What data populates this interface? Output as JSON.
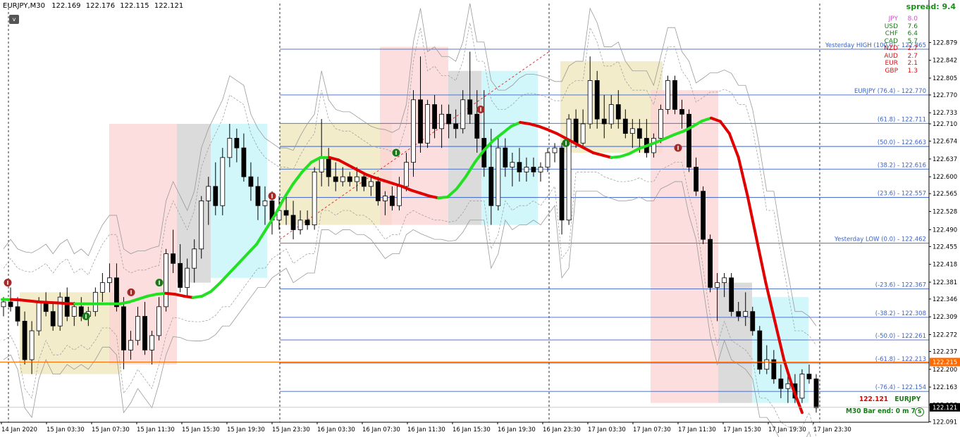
{
  "window": {
    "symbol": "EURJPY,M30",
    "ohlc": [
      "122.169",
      "122.176",
      "122.115",
      "122.121"
    ],
    "collapse_button": "v"
  },
  "spread_label": "spread: 9.4",
  "currency_strength": [
    {
      "currency": "JPY",
      "value": "8.0",
      "color": "#d64ad6"
    },
    {
      "currency": "USD",
      "value": "7.6",
      "color": "#1a7a1a"
    },
    {
      "currency": "CHF",
      "value": "6.4",
      "color": "#1a7a1a"
    },
    {
      "currency": "CAD",
      "value": "5.7",
      "color": "#1a7a1a"
    },
    {
      "currency": "NZD",
      "value": "2.7",
      "color": "#d21414"
    },
    {
      "currency": "AUD",
      "value": "2.7",
      "color": "#d21414"
    },
    {
      "currency": "EUR",
      "value": "2.1",
      "color": "#d21414"
    },
    {
      "currency": "GBP",
      "value": "1.3",
      "color": "#d21414"
    }
  ],
  "bottom_info": {
    "price": "122.121",
    "symbol": "EURJPY",
    "bar_end": "M30 Bar end: 0 m 7 s"
  },
  "chart_data": {
    "type": "candlestick",
    "y_range": [
      122.09,
      122.96
    ],
    "y_ticks": [
      "122.879",
      "122.842",
      "122.805",
      "122.770",
      "122.733",
      "122.710",
      "122.674",
      "122.637",
      "122.600",
      "122.565",
      "122.528",
      "122.490",
      "122.455",
      "122.418",
      "122.381",
      "122.346",
      "122.309",
      "122.272",
      "122.237",
      "122.200",
      "122.163",
      "122.126",
      "122.091"
    ],
    "x_tick_labels": [
      "14 Jan 2020",
      "15 Jan 03:30",
      "15 Jan 07:30",
      "15 Jan 11:30",
      "15 Jan 15:30",
      "15 Jan 19:30",
      "15 Jan 23:30",
      "16 Jan 03:30",
      "16 Jan 07:30",
      "16 Jan 11:30",
      "16 Jan 15:30",
      "16 Jan 19:30",
      "16 Jan 23:30",
      "17 Jan 03:30",
      "17 Jan 07:30",
      "17 Jan 11:30",
      "17 Jan 15:30",
      "17 Jan 19:30",
      "17 Jan 23:30"
    ],
    "fib_levels": [
      {
        "label": "Yesterday HIGH (100.0) - 122.865",
        "price": 122.865
      },
      {
        "label": "EURJPY (76.4) - 122.770",
        "price": 122.77
      },
      {
        "label": "(61.8) - 122.711",
        "price": 122.711
      },
      {
        "label": "(50.0) - 122.663",
        "price": 122.663
      },
      {
        "label": "(38.2) - 122.616",
        "price": 122.616
      },
      {
        "label": "(23.6) - 122.557",
        "price": 122.557
      },
      {
        "label": "Yesterday LOW (0.0) - 122.462",
        "price": 122.462
      },
      {
        "label": "(-23.6) - 122.367",
        "price": 122.367
      },
      {
        "label": "(-38.2) - 122.308",
        "price": 122.308
      },
      {
        "label": "(-50.0) - 122.261",
        "price": 122.261
      },
      {
        "label": "(-61.8) - 122.213",
        "price": 122.213
      },
      {
        "label": "(-76.4) - 122.154",
        "price": 122.154
      }
    ],
    "bid_line": {
      "price": 122.215,
      "label": "122.215",
      "color": "#ff6a00"
    },
    "current_price": {
      "price": 122.121,
      "label": "122.121"
    },
    "candles": [
      [
        122.33,
        122.35,
        122.31,
        122.34
      ],
      [
        122.34,
        122.37,
        122.32,
        122.33
      ],
      [
        122.33,
        122.35,
        122.29,
        122.3
      ],
      [
        122.3,
        122.32,
        122.21,
        122.22
      ],
      [
        122.22,
        122.3,
        122.19,
        122.28
      ],
      [
        122.28,
        122.35,
        122.27,
        122.34
      ],
      [
        122.34,
        122.36,
        122.31,
        122.32
      ],
      [
        122.32,
        122.34,
        122.28,
        122.29
      ],
      [
        122.29,
        122.36,
        122.28,
        122.35
      ],
      [
        122.35,
        122.37,
        122.3,
        122.31
      ],
      [
        122.31,
        122.34,
        122.29,
        122.33
      ],
      [
        122.33,
        122.35,
        122.3,
        122.31
      ],
      [
        122.31,
        122.33,
        122.29,
        122.32
      ],
      [
        122.32,
        122.37,
        122.31,
        122.36
      ],
      [
        122.36,
        122.4,
        122.34,
        122.38
      ],
      [
        122.38,
        122.42,
        122.36,
        122.39
      ],
      [
        122.39,
        122.42,
        122.32,
        122.33
      ],
      [
        122.33,
        122.35,
        122.2,
        122.24
      ],
      [
        122.24,
        122.28,
        122.22,
        122.26
      ],
      [
        122.26,
        122.33,
        122.25,
        122.31
      ],
      [
        122.31,
        122.34,
        122.23,
        122.24
      ],
      [
        122.24,
        122.28,
        122.21,
        122.27
      ],
      [
        122.27,
        122.35,
        122.26,
        122.33
      ],
      [
        122.33,
        122.45,
        122.32,
        122.44
      ],
      [
        122.44,
        122.49,
        122.4,
        122.42
      ],
      [
        122.42,
        122.46,
        122.36,
        122.37
      ],
      [
        122.37,
        122.43,
        122.35,
        122.41
      ],
      [
        122.41,
        122.47,
        122.38,
        122.45
      ],
      [
        122.45,
        122.56,
        122.43,
        122.55
      ],
      [
        122.55,
        122.6,
        122.5,
        122.58
      ],
      [
        122.58,
        122.63,
        122.52,
        122.54
      ],
      [
        122.54,
        122.66,
        122.52,
        122.64
      ],
      [
        122.64,
        122.71,
        122.62,
        122.68
      ],
      [
        122.68,
        122.7,
        122.63,
        122.66
      ],
      [
        122.66,
        122.69,
        122.59,
        122.6
      ],
      [
        122.6,
        122.63,
        122.55,
        122.58
      ],
      [
        122.58,
        122.6,
        122.51,
        122.54
      ],
      [
        122.54,
        122.58,
        122.5,
        122.55
      ],
      [
        122.55,
        122.57,
        122.48,
        122.51
      ],
      [
        122.51,
        122.56,
        122.49,
        122.53
      ],
      [
        122.53,
        122.56,
        122.5,
        122.52
      ],
      [
        122.52,
        122.55,
        122.47,
        122.49
      ],
      [
        122.49,
        122.53,
        122.48,
        122.51
      ],
      [
        122.51,
        122.53,
        122.49,
        122.5
      ],
      [
        122.5,
        122.62,
        122.49,
        122.61
      ],
      [
        122.61,
        122.72,
        122.58,
        122.64
      ],
      [
        122.64,
        122.66,
        122.58,
        122.6
      ],
      [
        122.6,
        122.63,
        122.57,
        122.59
      ],
      [
        122.59,
        122.62,
        122.58,
        122.6
      ],
      [
        122.6,
        122.61,
        122.58,
        122.59
      ],
      [
        122.59,
        122.62,
        122.57,
        122.6
      ],
      [
        122.6,
        122.61,
        122.57,
        122.58
      ],
      [
        122.58,
        122.6,
        122.56,
        122.59
      ],
      [
        122.59,
        122.6,
        122.54,
        122.55
      ],
      [
        122.55,
        122.57,
        122.52,
        122.56
      ],
      [
        122.56,
        122.58,
        122.53,
        122.54
      ],
      [
        122.54,
        122.6,
        122.53,
        122.58
      ],
      [
        122.58,
        122.65,
        122.57,
        122.63
      ],
      [
        122.63,
        122.78,
        122.6,
        122.76
      ],
      [
        122.76,
        122.85,
        122.65,
        122.67
      ],
      [
        122.67,
        122.76,
        122.66,
        122.75
      ],
      [
        122.75,
        122.77,
        122.68,
        122.7
      ],
      [
        122.7,
        122.75,
        122.66,
        122.73
      ],
      [
        122.73,
        122.75,
        122.68,
        122.71
      ],
      [
        122.71,
        122.74,
        122.68,
        122.7
      ],
      [
        122.7,
        122.78,
        122.69,
        122.76
      ],
      [
        122.76,
        122.86,
        122.71,
        122.73
      ],
      [
        122.73,
        122.78,
        122.65,
        122.68
      ],
      [
        122.68,
        122.78,
        122.6,
        122.62
      ],
      [
        122.62,
        122.7,
        122.5,
        122.54
      ],
      [
        122.54,
        122.68,
        122.53,
        122.66
      ],
      [
        122.66,
        122.68,
        122.6,
        122.62
      ],
      [
        122.62,
        122.65,
        122.58,
        122.63
      ],
      [
        122.63,
        122.66,
        122.59,
        122.61
      ],
      [
        122.61,
        122.64,
        122.59,
        122.62
      ],
      [
        122.62,
        122.64,
        122.6,
        122.61
      ],
      [
        122.61,
        122.63,
        122.59,
        122.62
      ],
      [
        122.62,
        122.66,
        122.61,
        122.65
      ],
      [
        122.65,
        122.67,
        122.63,
        122.66
      ],
      [
        122.66,
        122.67,
        122.48,
        122.51
      ],
      [
        122.51,
        122.73,
        122.5,
        122.72
      ],
      [
        122.72,
        122.74,
        122.66,
        122.67
      ],
      [
        122.67,
        122.74,
        122.66,
        122.71
      ],
      [
        122.71,
        122.85,
        122.7,
        122.8
      ],
      [
        122.8,
        122.82,
        122.7,
        122.72
      ],
      [
        122.72,
        122.77,
        122.68,
        122.71
      ],
      [
        122.71,
        122.77,
        122.7,
        122.75
      ],
      [
        122.75,
        122.78,
        122.7,
        122.72
      ],
      [
        122.72,
        122.74,
        122.68,
        122.69
      ],
      [
        122.69,
        122.72,
        122.66,
        122.7
      ],
      [
        122.7,
        122.72,
        122.65,
        122.68
      ],
      [
        122.68,
        122.72,
        122.64,
        122.65
      ],
      [
        122.65,
        122.69,
        122.64,
        122.68
      ],
      [
        122.68,
        122.75,
        122.67,
        122.74
      ],
      [
        122.74,
        122.81,
        122.73,
        122.8
      ],
      [
        122.8,
        122.81,
        122.73,
        122.74
      ],
      [
        122.74,
        122.76,
        122.7,
        122.73
      ],
      [
        122.73,
        122.74,
        122.61,
        122.62
      ],
      [
        122.62,
        122.64,
        122.56,
        122.57
      ],
      [
        122.57,
        122.58,
        122.46,
        122.47
      ],
      [
        122.47,
        122.48,
        122.36,
        122.37
      ],
      [
        122.37,
        122.4,
        122.3,
        122.38
      ],
      [
        122.38,
        122.4,
        122.35,
        122.39
      ],
      [
        122.39,
        122.4,
        122.31,
        122.32
      ],
      [
        122.32,
        122.34,
        122.3,
        122.31
      ],
      [
        122.31,
        122.36,
        122.29,
        122.32
      ],
      [
        122.32,
        122.33,
        122.27,
        122.28
      ],
      [
        122.28,
        122.29,
        122.19,
        122.2
      ],
      [
        122.2,
        122.25,
        122.19,
        122.22
      ],
      [
        122.22,
        122.24,
        122.17,
        122.18
      ],
      [
        122.18,
        122.21,
        122.14,
        122.16
      ],
      [
        122.16,
        122.19,
        122.13,
        122.17
      ],
      [
        122.17,
        122.19,
        122.13,
        122.14
      ],
      [
        122.14,
        122.2,
        122.13,
        122.19
      ],
      [
        122.19,
        122.21,
        122.17,
        122.18
      ],
      [
        122.18,
        122.19,
        122.11,
        122.12
      ]
    ],
    "signal_line": [
      122.345,
      122.345,
      122.344,
      122.342,
      122.34,
      122.339,
      122.338,
      122.337,
      122.336,
      122.336,
      122.336,
      122.336,
      122.336,
      122.336,
      122.34,
      122.346,
      122.352,
      122.356,
      122.358,
      122.356,
      122.352,
      122.349,
      122.352,
      122.362,
      122.38,
      122.4,
      122.42,
      122.44,
      122.46,
      122.49,
      122.52,
      122.555,
      122.585,
      122.61,
      122.63,
      122.64,
      122.64,
      122.635,
      122.625,
      122.615,
      122.605,
      122.598,
      122.592,
      122.586,
      122.58,
      122.572,
      122.566,
      122.56,
      122.556,
      122.558,
      122.575,
      122.6,
      122.63,
      122.655,
      122.675,
      122.69,
      122.705,
      122.713,
      122.71,
      122.705,
      122.698,
      122.69,
      122.68,
      122.67,
      122.66,
      122.65,
      122.645,
      122.64,
      122.642,
      122.648,
      122.658,
      122.665,
      122.672,
      122.68,
      122.688,
      122.695,
      122.705,
      122.716,
      122.722,
      122.715,
      122.69,
      122.64,
      122.56,
      122.47,
      122.38,
      122.3,
      122.22,
      122.16,
      122.11
    ],
    "signal_colors": [
      "#e00000",
      "#22e022"
    ],
    "zones": [
      {
        "kind": "consolidation",
        "color": "#ede6b9"
      },
      {
        "kind": "sell",
        "color": "#fbd3d3"
      },
      {
        "kind": "neutral",
        "color": "#cfcfcf"
      },
      {
        "kind": "buy",
        "color": "#c2f4fa"
      }
    ],
    "arrows": [
      {
        "type": "sell",
        "color": "#a52a2a"
      },
      {
        "type": "buy",
        "color": "#1a7a1a"
      }
    ]
  }
}
